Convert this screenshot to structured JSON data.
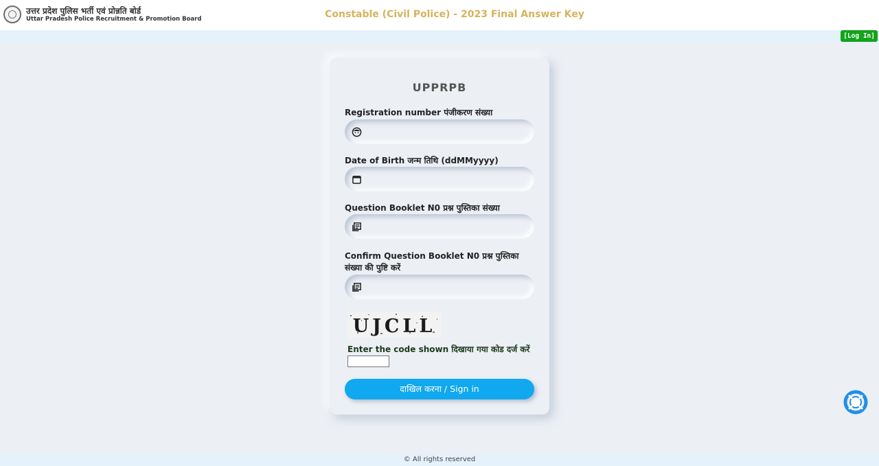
{
  "header": {
    "org_hindi": "उत्तर प्रदेश पुलिस भर्ती एवं प्रोन्नति बोर्ड",
    "org_english": "Uttar Pradesh Police Recruitment & Promotion Board",
    "title": "Constable (Civil Police) - 2023 Final Answer Key",
    "login_label": "[Log In]"
  },
  "form": {
    "title": "UPPRPB",
    "registration": {
      "label": "Registration number पंजीकरण संख्या",
      "value": "",
      "placeholder": "",
      "icon": "face-icon"
    },
    "dob": {
      "label": "Date of Birth जन्म तिथि (ddMMyyyy)",
      "value": "",
      "placeholder": "",
      "icon": "calendar-icon"
    },
    "booklet": {
      "label": "Question Booklet N0 प्रश्न पुस्तिका संख्या",
      "value": "",
      "placeholder": "",
      "icon": "booklet-icon"
    },
    "confirm_booklet": {
      "label": "Confirm Question Booklet N0 प्रश्न पुस्तिका संख्या की पुष्टि करें",
      "value": "",
      "placeholder": "",
      "icon": "booklet-icon"
    },
    "captcha": {
      "code": "UJCLL",
      "label": "Enter the code shown दिखाया गया कोड दर्ज करें",
      "value": ""
    },
    "signin_label": "दाखिल करना / Sign in"
  },
  "footer": {
    "text": "© All rights reserved"
  },
  "colors": {
    "accent": "#10a8ee",
    "title": "#d6b35b",
    "login": "#14a31b",
    "background": "#eceff4"
  }
}
